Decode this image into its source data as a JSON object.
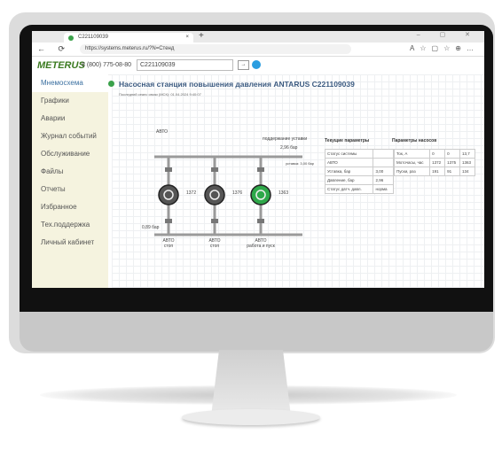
{
  "browser": {
    "tab_title": "C221109039",
    "new_tab_label": "+",
    "tab_close": "×",
    "window_controls": "– ▢ ✕",
    "url": "https://systems.meterus.ru/?N=Стенд",
    "nav_icons": "← ⟳",
    "toolbar_icons": "A☆▢☆⊕…"
  },
  "header": {
    "logo": "METERUS",
    "phone": "8 (800) 775-08-80",
    "device_id": "C221109039",
    "go_label": "→"
  },
  "sidebar": {
    "items": [
      {
        "label": "Мнемосхема",
        "active": true
      },
      {
        "label": "Графики"
      },
      {
        "label": "Аварии"
      },
      {
        "label": "Журнал событий"
      },
      {
        "label": "Обслуживание"
      },
      {
        "label": "Файлы"
      },
      {
        "label": "Отчеты"
      },
      {
        "label": "Избранное"
      },
      {
        "label": "Тех.поддержка"
      },
      {
        "label": "Личный кабинет"
      }
    ]
  },
  "main": {
    "title": "Насосная станция повышения давления ANTARUS C221109039",
    "last_session": "Последний сеанс связи (МСК): 01.04.2024 9:40:07",
    "mode_label": "АВТО",
    "maintain_label": "поддержание уставки",
    "outlet_pressure": "2,96 бар",
    "setpoint_label": "уставка: 3,00 бар",
    "inlet_pressure": "0,89 бар",
    "pumps": [
      {
        "speed": "1372",
        "mode": "АВТО",
        "state": "стоп",
        "color": "#555555"
      },
      {
        "speed": "1376",
        "mode": "АВТО",
        "state": "стоп",
        "color": "#555555"
      },
      {
        "speed": "1363",
        "mode": "АВТО",
        "state": "работа и пуск",
        "color": "#2ea84a"
      }
    ],
    "current_params": {
      "heading": "Текущие параметры",
      "rows": [
        [
          "Статус системы",
          ""
        ],
        [
          "АВТО",
          ""
        ],
        [
          "Уставка, бар",
          "3,00"
        ],
        [
          "Давление, бар",
          "2,96"
        ],
        [
          "Статус датч. давл.",
          "норма"
        ]
      ]
    },
    "pump_params": {
      "heading": "Параметры насосов",
      "rows": [
        [
          "Ток, А",
          "0",
          "0",
          "13,7"
        ],
        [
          "Моточасы, час",
          "1372",
          "1375",
          "1363"
        ],
        [
          "Пуски, раз",
          "191",
          "91",
          "134"
        ]
      ]
    }
  },
  "colors": {
    "accent_green": "#3aa14a",
    "sidebar_bg": "#f5f3df",
    "title_blue": "#3b5a80"
  }
}
